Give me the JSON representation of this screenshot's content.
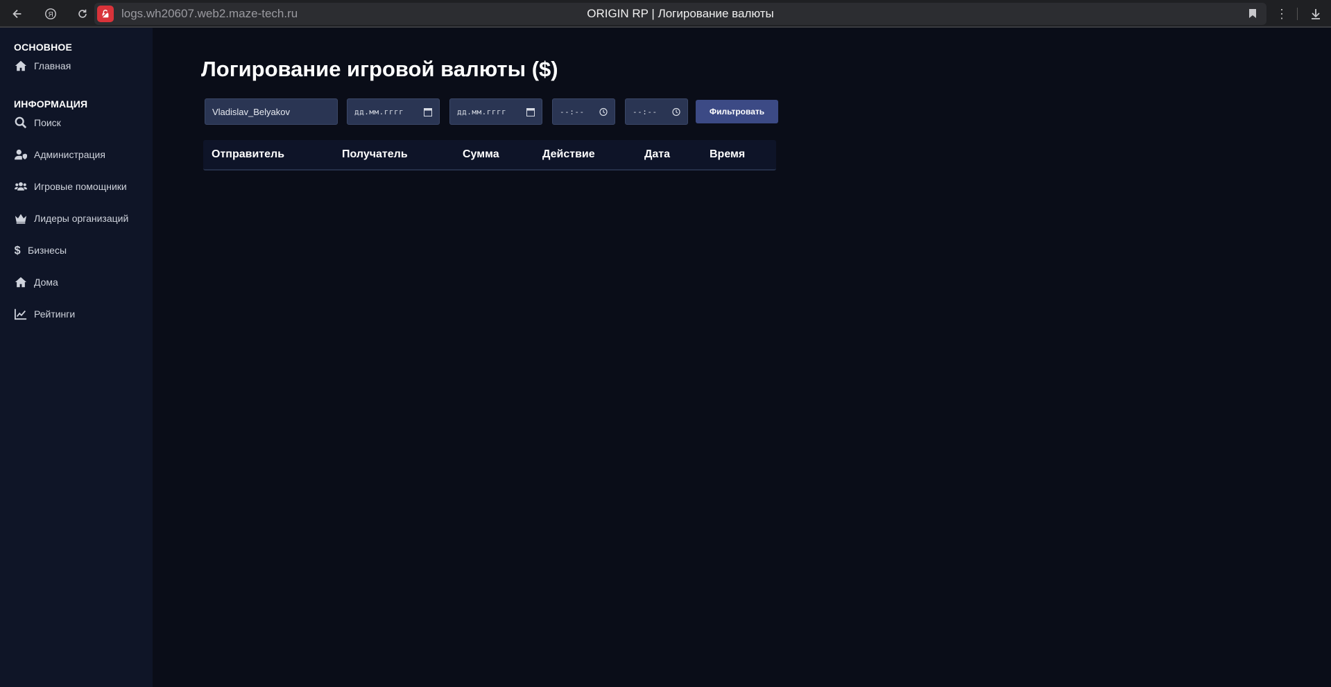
{
  "browser": {
    "url": "logs.wh20607.web2.maze-tech.ru",
    "tab_title": "ORIGIN RP | Логирование валюты"
  },
  "sidebar": {
    "section_main": "ОСНОВНОЕ",
    "section_info": "ИНФОРМАЦИЯ",
    "items": [
      {
        "label": "Главная",
        "icon": "home-icon"
      },
      {
        "label": "Поиск",
        "icon": "search-icon"
      },
      {
        "label": "Администрация",
        "icon": "user-shield-icon"
      },
      {
        "label": "Игровые помощники",
        "icon": "users-icon"
      },
      {
        "label": "Лидеры организаций",
        "icon": "crown-icon"
      },
      {
        "label": "Бизнесы",
        "icon": "dollar-icon"
      },
      {
        "label": "Дома",
        "icon": "home-icon"
      },
      {
        "label": "Рейтинги",
        "icon": "chart-line-icon"
      }
    ]
  },
  "main": {
    "title": "Логирование игровой валюты ($)",
    "filters": {
      "nickname_value": "Vladislav_Belyakov",
      "date_from_placeholder": "дд.мм.гггг",
      "date_to_placeholder": "дд.мм.гггг",
      "time_from_placeholder": "--:--",
      "time_to_placeholder": "--:--",
      "filter_button": "Фильтровать"
    },
    "table": {
      "columns": [
        "Отправитель",
        "Получатель",
        "Сумма",
        "Действие",
        "Дата",
        "Время"
      ],
      "rows": []
    }
  },
  "colors": {
    "sidebar_bg": "#0f1527",
    "main_bg": "#0a0d18",
    "input_bg": "#2a3553",
    "button_bg": "#3c4a85"
  }
}
